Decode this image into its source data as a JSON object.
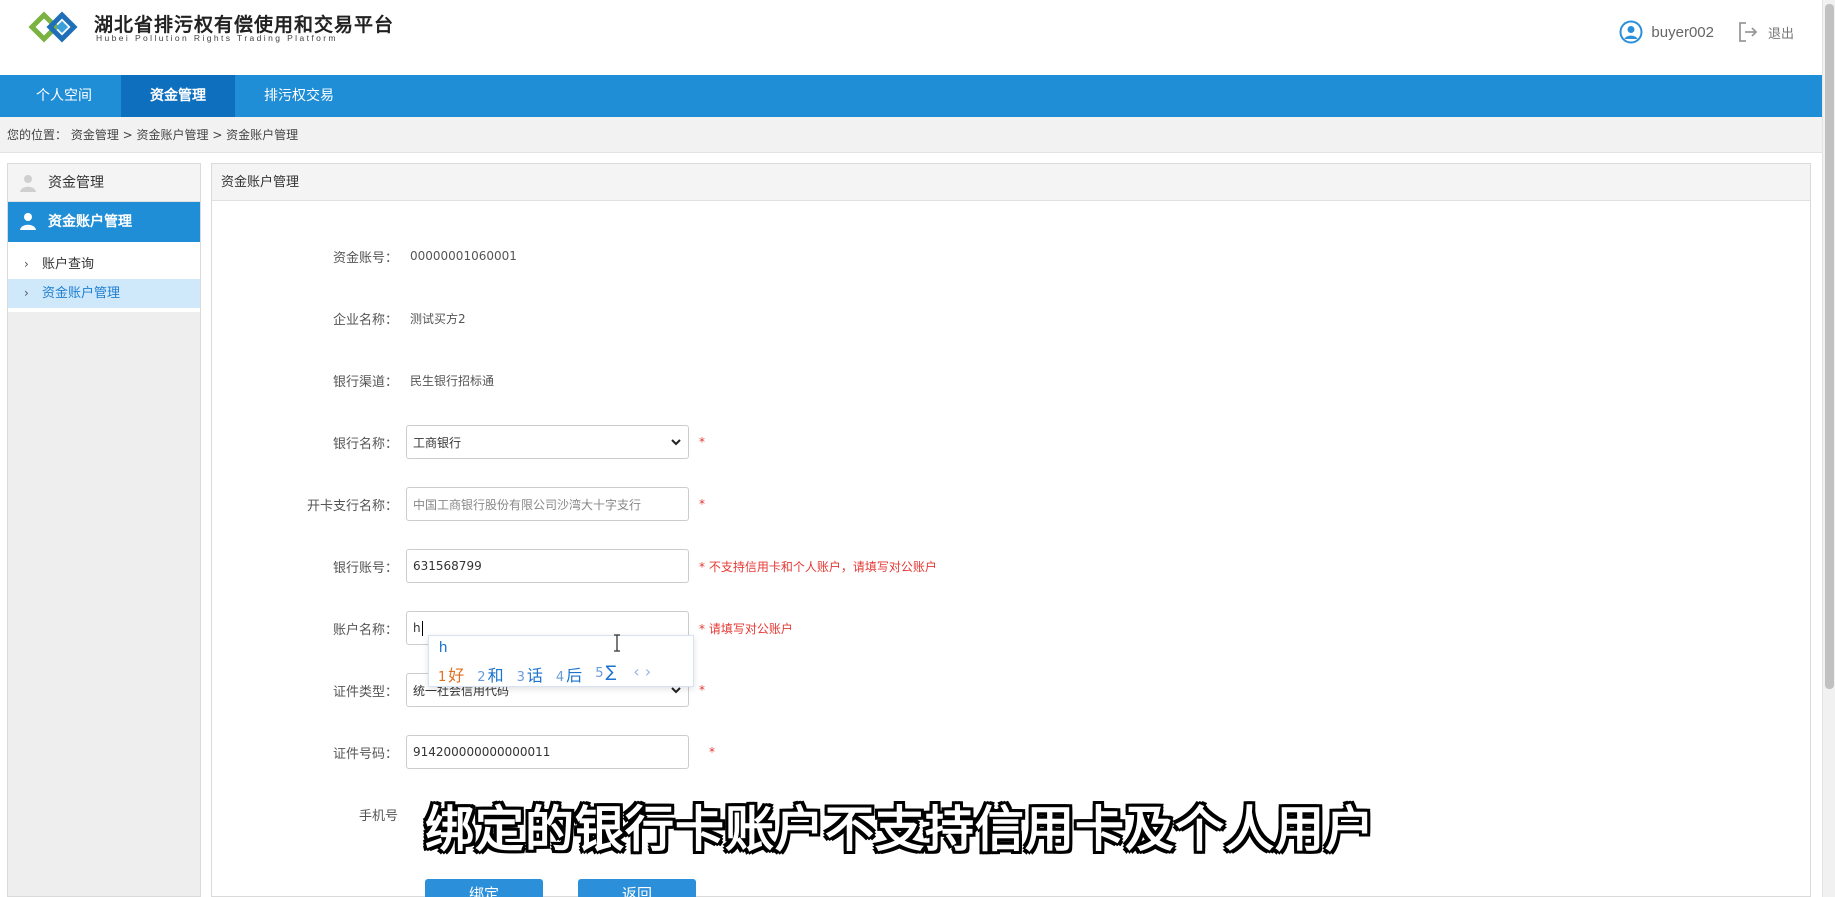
{
  "header": {
    "title": "湖北省排污权有偿使用和交易平台",
    "subtitle": "Hubei Pollution Rights Trading Platform",
    "username": "buyer002",
    "logout": "退出"
  },
  "nav": {
    "items": [
      {
        "label": "个人空间",
        "active": false
      },
      {
        "label": "资金管理",
        "active": true
      },
      {
        "label": "排污权交易",
        "active": false
      }
    ]
  },
  "breadcrumb": "您的位置：  资金管理 > 资金账户管理 > 资金账户管理",
  "sidebar": {
    "section": "资金管理",
    "active": "资金账户管理",
    "items": [
      {
        "label": "账户查询"
      },
      {
        "label": "资金账户管理"
      }
    ]
  },
  "main": {
    "title": "资金账户管理",
    "fields": {
      "account_no": {
        "label": "资金账号：",
        "value": "00000001060001"
      },
      "company": {
        "label": "企业名称：",
        "value": "测试买方2"
      },
      "channel": {
        "label": "银行渠道：",
        "value": "民生银行招标通"
      },
      "bank_name": {
        "label": "银行名称：",
        "value": "工商银行",
        "req": "*"
      },
      "branch": {
        "label": "开卡支行名称：",
        "value": "中国工商银行股份有限公司沙湾大十字支行",
        "req": "*"
      },
      "bank_account": {
        "label": "银行账号：",
        "value": "631568799",
        "req": "* 不支持信用卡和个人账户，请填写对公账户"
      },
      "account_name": {
        "label": "账户名称：",
        "value": "h",
        "req": "* 请填写对公账户"
      },
      "cert_type": {
        "label": "证件类型：",
        "value": "统一社会信用代码",
        "req": "*"
      },
      "cert_no": {
        "label": "证件号码：",
        "value": "914200000000000011",
        "req": "*"
      },
      "phone": {
        "label": "手机号"
      }
    },
    "buttons": {
      "bind": "绑定",
      "back": "返回"
    }
  },
  "ime": {
    "input": "h",
    "candidates": [
      {
        "n": "1",
        "text": "好"
      },
      {
        "n": "2",
        "text": "和"
      },
      {
        "n": "3",
        "text": "话"
      },
      {
        "n": "4",
        "text": "后"
      },
      {
        "n": "5",
        "text": "∑"
      }
    ],
    "arrows": "‹ ›"
  },
  "caption": "绑定的银行卡账户不支持信用卡及个人用户",
  "colors": {
    "brand": "#1f8ed6",
    "nav_active": "#0d6fbe",
    "required": "#e53935"
  }
}
